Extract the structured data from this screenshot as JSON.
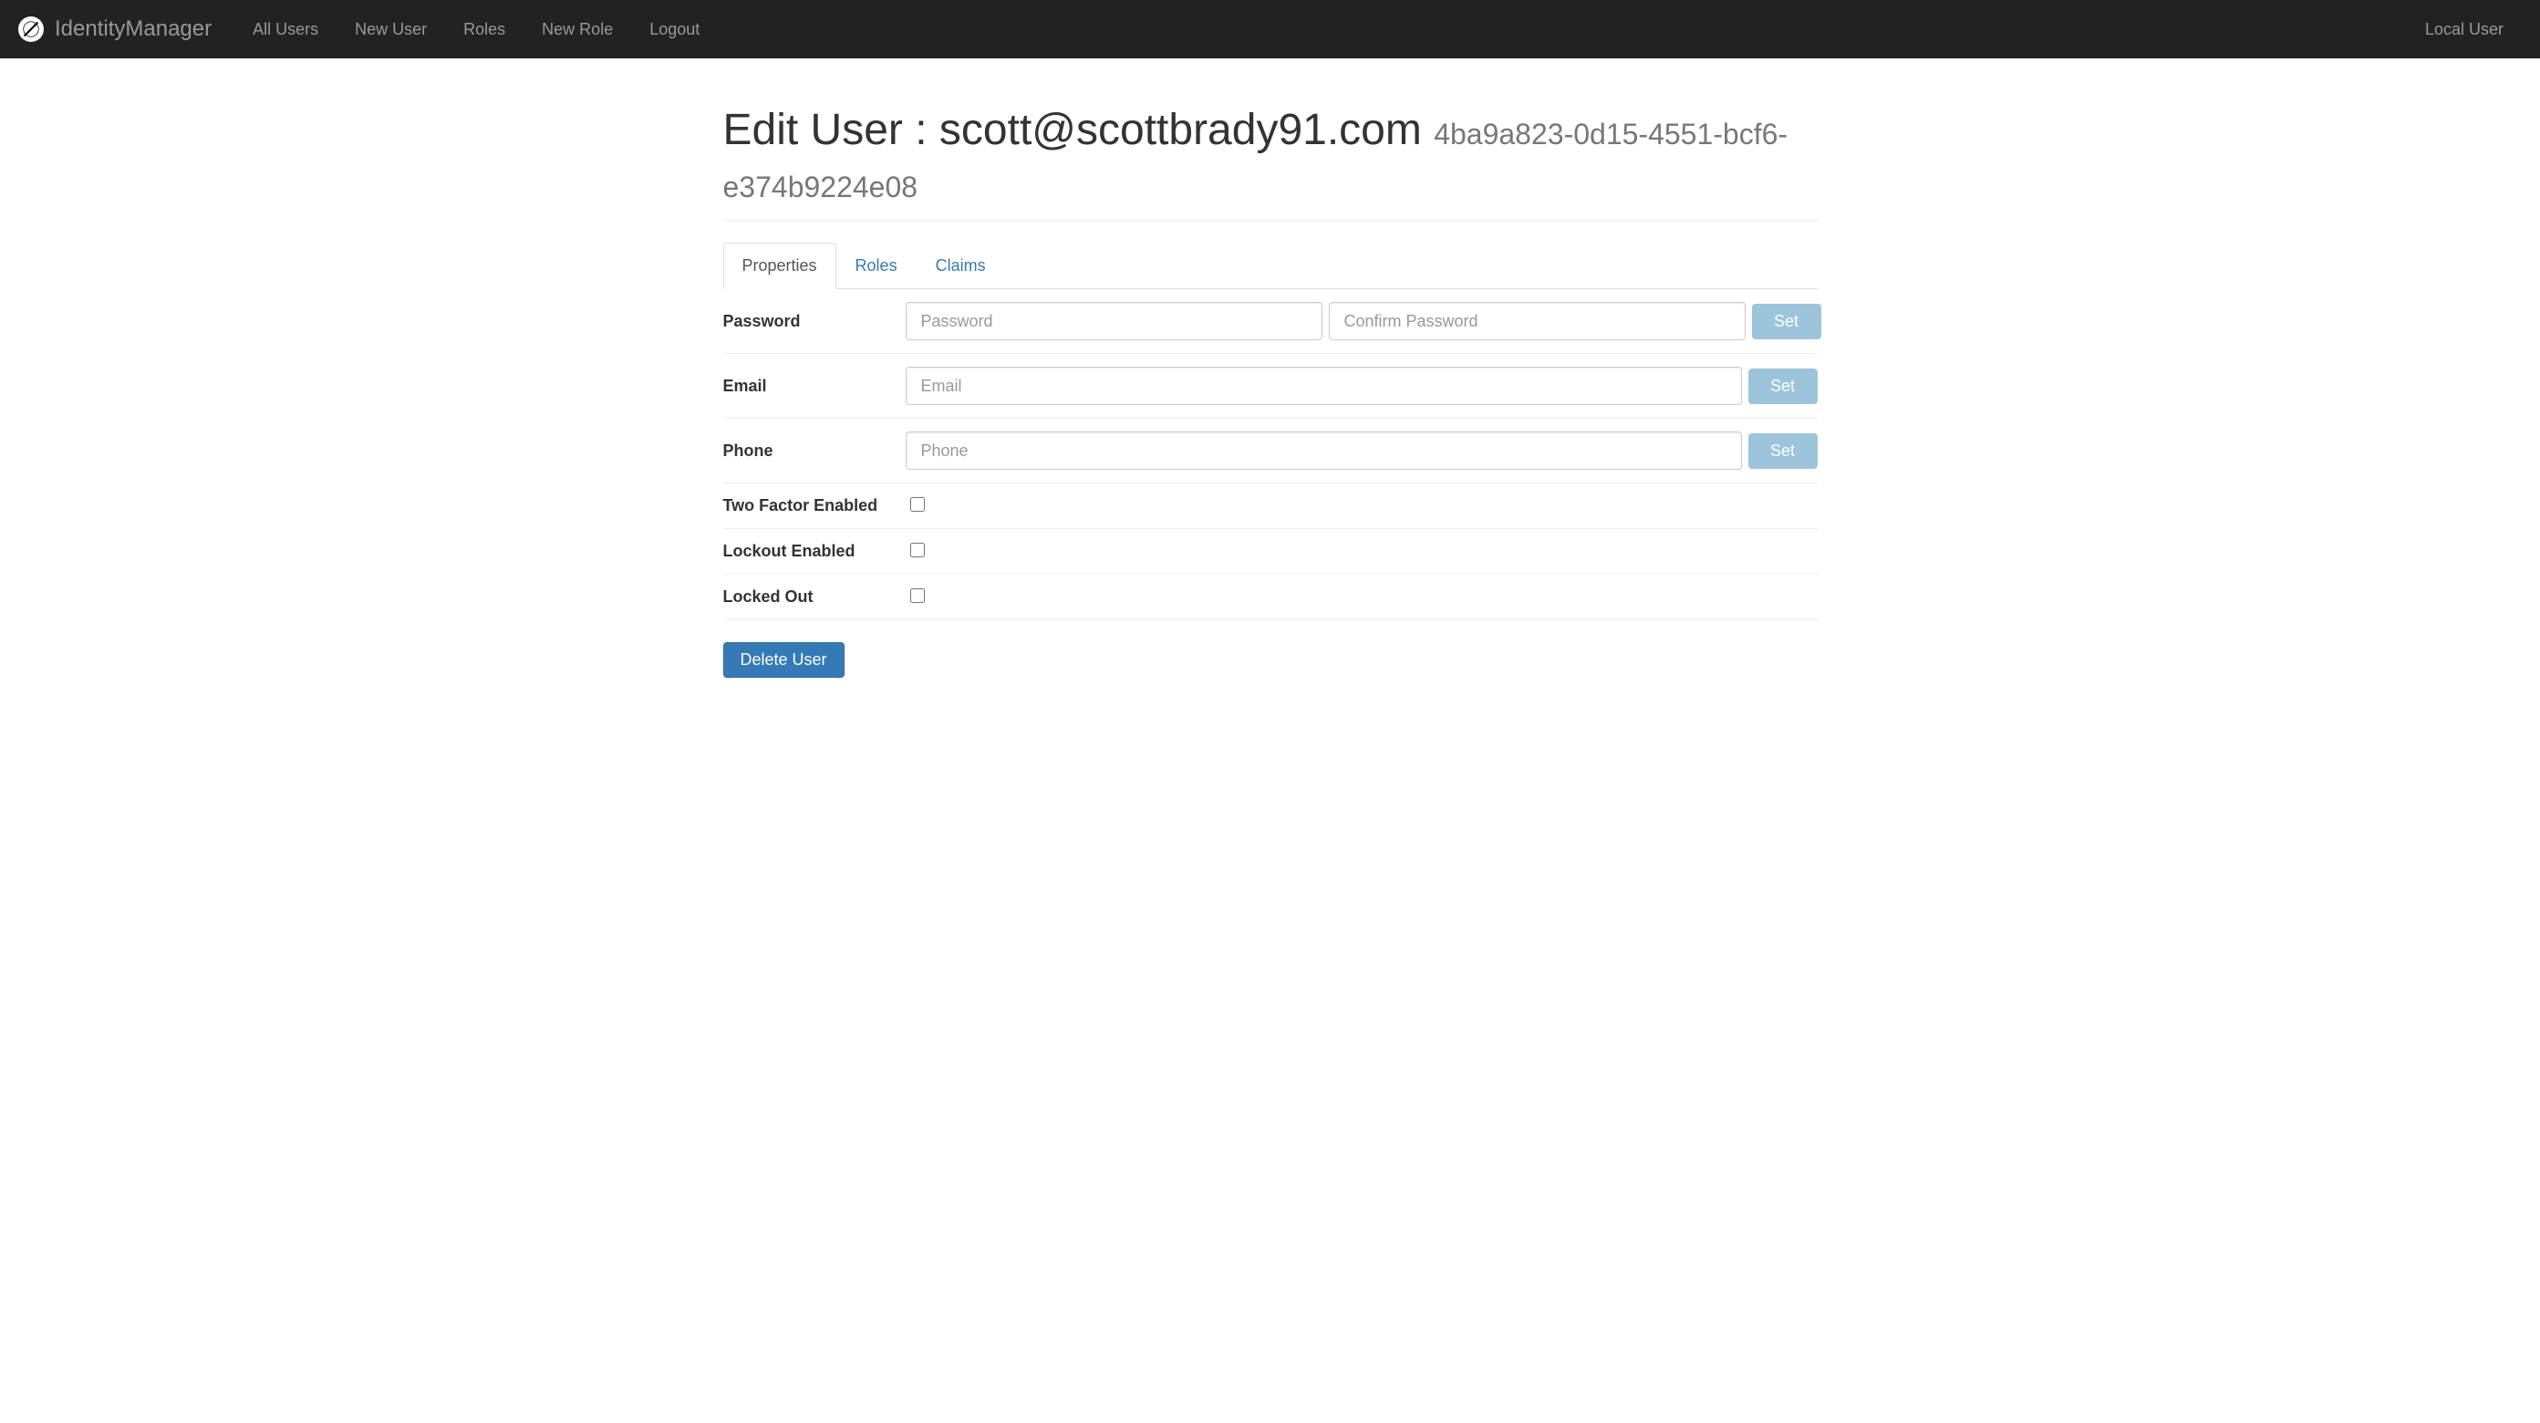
{
  "brand": "IdentityManager",
  "nav": {
    "all_users": "All Users",
    "new_user": "New User",
    "roles": "Roles",
    "new_role": "New Role",
    "logout": "Logout",
    "local_user": "Local User"
  },
  "page": {
    "title_prefix": "Edit User : ",
    "username": "scott@scottbrady91.com",
    "user_id": "4ba9a823-0d15-4551-bcf6-e374b9224e08"
  },
  "tabs": {
    "properties": "Properties",
    "roles": "Roles",
    "claims": "Claims"
  },
  "form": {
    "password": {
      "label": "Password",
      "placeholder": "Password",
      "confirm_placeholder": "Confirm Password",
      "button": "Set"
    },
    "email": {
      "label": "Email",
      "placeholder": "Email",
      "button": "Set"
    },
    "phone": {
      "label": "Phone",
      "placeholder": "Phone",
      "button": "Set"
    },
    "two_factor": {
      "label": "Two Factor Enabled"
    },
    "lockout_enabled": {
      "label": "Lockout Enabled"
    },
    "locked_out": {
      "label": "Locked Out"
    }
  },
  "actions": {
    "delete_user": "Delete User"
  }
}
